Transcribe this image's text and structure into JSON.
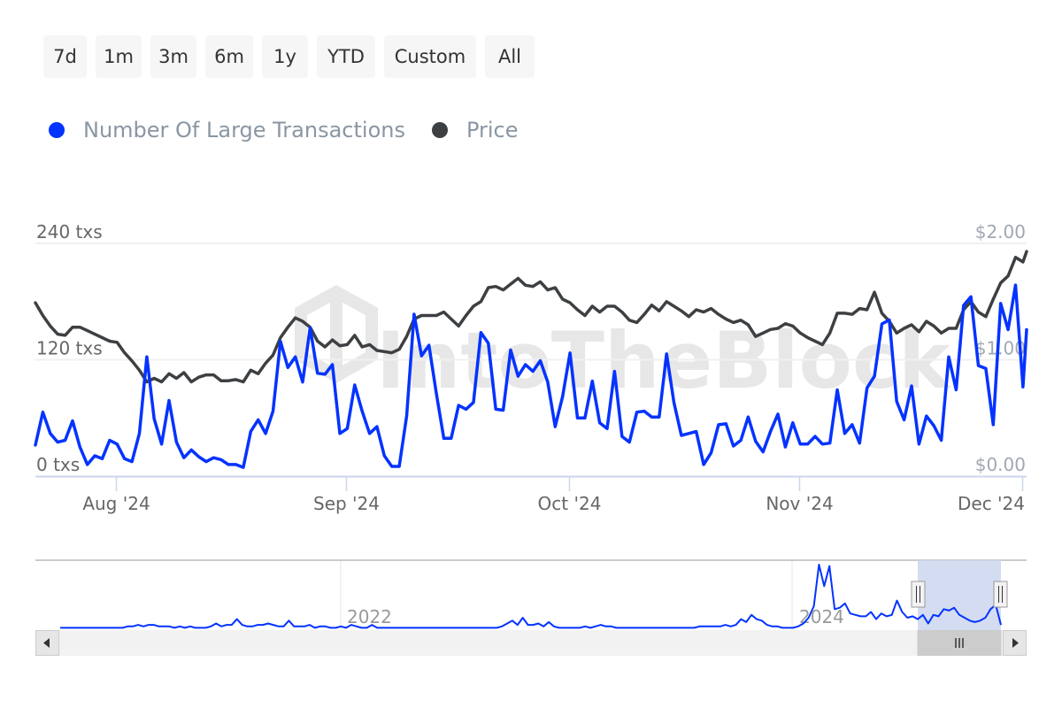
{
  "range_selector": {
    "buttons": [
      "7d",
      "1m",
      "3m",
      "6m",
      "1y",
      "YTD",
      "Custom",
      "All"
    ]
  },
  "legend": {
    "items": [
      {
        "label": "Number Of Large Transactions",
        "color": "#0433ff"
      },
      {
        "label": "Price",
        "color": "#3d4043"
      }
    ]
  },
  "watermark": "IntoTheBlock",
  "navigator": {
    "year_labels": [
      "2022",
      "2024"
    ],
    "scroll_left_icon": "arrow-left",
    "scroll_right_icon": "arrow-right",
    "grip_icon": "grip-lines"
  },
  "chart_data": {
    "type": "line",
    "title": "",
    "x_start": "2024-07-21",
    "x_end": "2024-12-02",
    "x_ticks": [
      "Aug '24",
      "Sep '24",
      "Oct '24",
      "Nov '24",
      "Dec '24"
    ],
    "x_tick_days": [
      11,
      42,
      72,
      103,
      133
    ],
    "y_left": {
      "label": "",
      "ticks": [
        "0 txs",
        "120 txs",
        "240 txs"
      ],
      "tick_values": [
        0,
        120,
        240
      ],
      "range": [
        0,
        240
      ]
    },
    "y_right": {
      "label": "",
      "ticks": [
        "$0.00",
        "$1.00",
        "$2.00"
      ],
      "tick_values": [
        0,
        1,
        2
      ],
      "range": [
        0,
        2
      ]
    },
    "grid": true,
    "legend_position": "top-left",
    "series": [
      {
        "name": "Number Of Large Transactions",
        "axis": "left",
        "color": "#0433ff",
        "values": [
          32,
          66,
          44,
          35,
          37,
          57,
          30,
          12,
          21,
          18,
          37,
          33,
          18,
          15,
          44,
          123,
          59,
          33,
          78,
          35,
          19,
          27,
          20,
          15,
          19,
          17,
          12,
          12,
          9,
          46,
          58,
          44,
          67,
          139,
          112,
          123,
          97,
          153,
          106,
          105,
          115,
          44,
          49,
          94,
          67,
          44,
          51,
          21,
          10,
          10,
          62,
          167,
          124,
          135,
          85,
          39,
          39,
          73,
          69,
          76,
          148,
          137,
          69,
          68,
          130,
          103,
          115,
          108,
          119,
          97,
          51,
          82,
          127,
          60,
          60,
          98,
          55,
          49,
          108,
          41,
          35,
          66,
          67,
          61,
          61,
          126,
          76,
          42,
          44,
          46,
          12,
          24,
          53,
          54,
          31,
          37,
          61,
          36,
          25,
          46,
          64,
          30,
          55,
          33,
          33,
          41,
          33,
          34,
          89,
          44,
          53,
          34,
          91,
          103,
          157,
          161,
          77,
          58,
          93,
          33,
          62,
          52,
          37,
          123,
          89,
          176,
          185,
          114,
          111,
          53,
          178,
          151,
          197,
          92,
          151
        ]
      },
      {
        "name": "Price",
        "axis": "right",
        "color": "#3d4043",
        "values": [
          1.49,
          1.38,
          1.29,
          1.22,
          1.21,
          1.28,
          1.28,
          1.25,
          1.22,
          1.19,
          1.16,
          1.15,
          1.06,
          0.99,
          0.91,
          0.81,
          0.84,
          0.81,
          0.88,
          0.84,
          0.89,
          0.81,
          0.85,
          0.87,
          0.87,
          0.82,
          0.82,
          0.83,
          0.81,
          0.91,
          0.88,
          0.97,
          1.04,
          1.19,
          1.28,
          1.36,
          1.33,
          1.28,
          1.16,
          1.11,
          1.17,
          1.12,
          1.13,
          1.21,
          1.11,
          1.13,
          1.08,
          1.07,
          1.06,
          1.09,
          1.2,
          1.35,
          1.38,
          1.38,
          1.38,
          1.41,
          1.35,
          1.29,
          1.38,
          1.46,
          1.5,
          1.62,
          1.63,
          1.6,
          1.65,
          1.7,
          1.64,
          1.63,
          1.67,
          1.6,
          1.62,
          1.52,
          1.49,
          1.43,
          1.38,
          1.46,
          1.41,
          1.46,
          1.46,
          1.41,
          1.34,
          1.32,
          1.39,
          1.47,
          1.42,
          1.5,
          1.46,
          1.42,
          1.37,
          1.43,
          1.41,
          1.44,
          1.39,
          1.35,
          1.32,
          1.34,
          1.3,
          1.2,
          1.23,
          1.26,
          1.27,
          1.31,
          1.29,
          1.23,
          1.19,
          1.16,
          1.13,
          1.23,
          1.4,
          1.4,
          1.39,
          1.44,
          1.43,
          1.58,
          1.4,
          1.33,
          1.23,
          1.27,
          1.3,
          1.24,
          1.33,
          1.29,
          1.23,
          1.27,
          1.27,
          1.43,
          1.5,
          1.41,
          1.37,
          1.52,
          1.66,
          1.72,
          1.88,
          1.84,
          1.93
        ]
      }
    ],
    "navigator_series": {
      "name": "Number Of Large Transactions (full history)",
      "x_range": [
        "2020",
        "2024-12"
      ],
      "values": [
        1,
        1,
        1,
        1,
        1,
        1,
        1,
        1,
        1,
        1,
        1,
        1,
        1,
        2,
        2,
        3,
        2,
        3,
        3,
        2,
        2,
        2,
        1,
        2,
        1,
        2,
        1,
        1,
        1,
        2,
        4,
        2,
        3,
        3,
        7,
        3,
        2,
        2,
        3,
        3,
        4,
        3,
        2,
        2,
        6,
        2,
        2,
        2,
        3,
        1,
        2,
        2,
        1,
        1,
        2,
        1,
        3,
        2,
        1,
        1,
        3,
        1,
        1,
        1,
        1,
        1,
        1,
        1,
        1,
        1,
        1,
        1,
        1,
        1,
        1,
        1,
        1,
        1,
        1,
        1,
        1,
        1,
        1,
        1,
        1,
        2,
        4,
        6,
        3,
        8,
        3,
        3,
        4,
        2,
        5,
        2,
        1,
        1,
        1,
        1,
        1,
        2,
        1,
        2,
        3,
        2,
        2,
        1,
        1,
        1,
        1,
        1,
        1,
        1,
        1,
        1,
        1,
        1,
        1,
        1,
        1,
        1,
        1,
        2,
        2,
        2,
        2,
        2,
        3,
        2,
        3,
        7,
        5,
        10,
        7,
        6,
        3,
        2,
        2,
        1,
        1,
        1,
        2,
        4,
        8,
        16,
        45,
        30,
        44,
        14,
        15,
        18,
        11,
        10,
        9,
        9,
        12,
        7,
        11,
        9,
        10,
        20,
        12,
        8,
        9,
        7,
        10,
        4,
        10,
        9,
        14,
        13,
        15,
        10,
        8,
        6,
        5,
        6,
        8,
        14,
        17,
        3
      ]
    }
  }
}
